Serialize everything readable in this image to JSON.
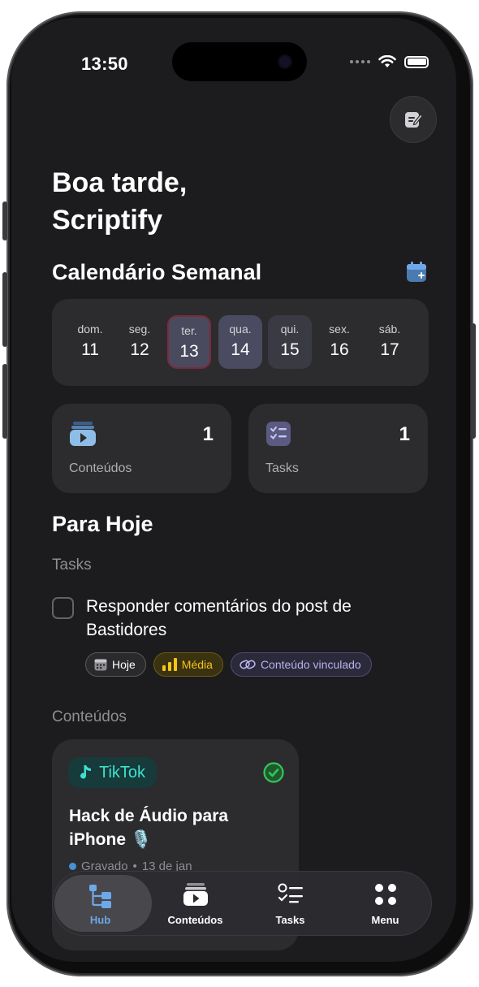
{
  "status_bar": {
    "time": "13:50"
  },
  "header": {
    "greeting_line1": "Boa tarde,",
    "greeting_line2": "Scriptify"
  },
  "calendar": {
    "title": "Calendário Semanal",
    "days": [
      {
        "name": "dom.",
        "date": "11"
      },
      {
        "name": "seg.",
        "date": "12"
      },
      {
        "name": "ter.",
        "date": "13"
      },
      {
        "name": "qua.",
        "date": "14"
      },
      {
        "name": "qui.",
        "date": "15"
      },
      {
        "name": "sex.",
        "date": "16"
      },
      {
        "name": "sáb.",
        "date": "17"
      }
    ]
  },
  "stats": {
    "conteudos": {
      "label": "Conteúdos",
      "count": "1"
    },
    "tasks": {
      "label": "Tasks",
      "count": "1"
    }
  },
  "today": {
    "title": "Para Hoje",
    "tasks_heading": "Tasks",
    "task": {
      "text": "Responder comentários do post de Bastidores",
      "chips": {
        "date": "Hoje",
        "priority": "Média",
        "linked": "Conteúdo vinculado"
      }
    },
    "content_heading": "Conteúdos",
    "content_card": {
      "platform": "TikTok",
      "title": "Hack de Áudio para iPhone 🎙️",
      "status": "Gravado",
      "date": "13 de jan"
    }
  },
  "colors": {
    "accent_blue": "#6ea8e8",
    "priority_yellow": "#f5c518",
    "tiktok_teal": "#3ee0d0",
    "done_green": "#34c759"
  },
  "tabbar": {
    "items": [
      {
        "label": "Hub",
        "icon": "hub-tree-icon"
      },
      {
        "label": "Conteúdos",
        "icon": "play-folder-icon"
      },
      {
        "label": "Tasks",
        "icon": "checklist-icon"
      },
      {
        "label": "Menu",
        "icon": "grid-dots-icon"
      }
    ]
  }
}
